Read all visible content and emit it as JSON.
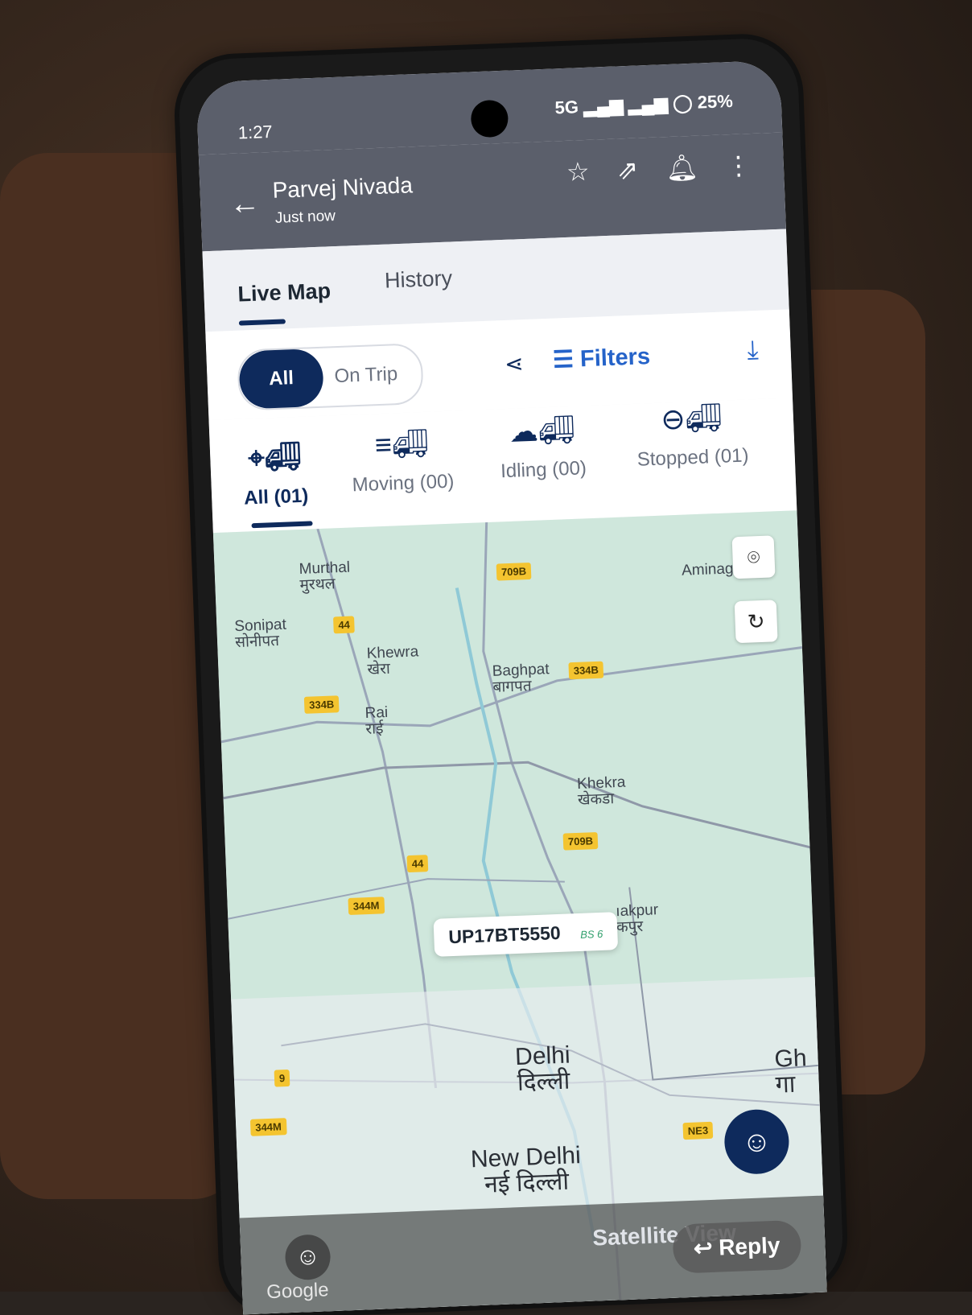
{
  "status_bar": {
    "time": "1:27",
    "network": "5G",
    "battery": "25%"
  },
  "header": {
    "title": "Parvej Nivada",
    "subtitle": "Just now"
  },
  "tabs": [
    {
      "label": "Live Map"
    },
    {
      "label": "History"
    }
  ],
  "toolbar": {
    "seg_all": "All",
    "seg_on_trip": "On Trip",
    "filters_label": "Filters"
  },
  "categories": [
    {
      "label": "All (01)"
    },
    {
      "label": "Moving (00)"
    },
    {
      "label": "Idling (00)"
    },
    {
      "label": "Stopped (01)"
    }
  ],
  "map": {
    "places": {
      "murthal": "Murthal",
      "murthal_hi": "मुरथल",
      "sonipat": "Sonipat",
      "sonipat_hi": "सोनीपत",
      "khewra": "Khewra",
      "khewra_hi": "खेरा",
      "rai": "Rai",
      "rai_hi": "राई",
      "baghpat": "Baghpat",
      "baghpat_hi": "बागपत",
      "aminagar": "Aminagar",
      "khekra": "Khekra",
      "khekra_hi": "खेकडा",
      "loni": "ıakpur",
      "loni_hi": "कपुर",
      "delhi": "Delhi",
      "delhi_hi": "दिल्ली",
      "new_delhi": "New Delhi",
      "new_delhi_hi": "नई दिल्ली",
      "gh": "Gh",
      "gh_hi": "गा"
    },
    "shields": {
      "s709b_top": "709B",
      "s44_top": "44",
      "s334b_left": "334B",
      "s334b_right": "334B",
      "s709b_mid": "709B",
      "s44_mid": "44",
      "s344m_top": "344M",
      "s9": "9",
      "s344m_bottom": "344M",
      "ne3": "NE3"
    },
    "vehicle_plate": "UP17BT5550",
    "vehicle_badge": "BS 6",
    "google_logo": "Google",
    "satellite_label": "Satellite View"
  },
  "overlay": {
    "reply_label": "Reply"
  },
  "colors": {
    "primary": "#0e2a5c",
    "link": "#2563c9",
    "map": "#cfe7dc",
    "shield": "#f4c430"
  }
}
